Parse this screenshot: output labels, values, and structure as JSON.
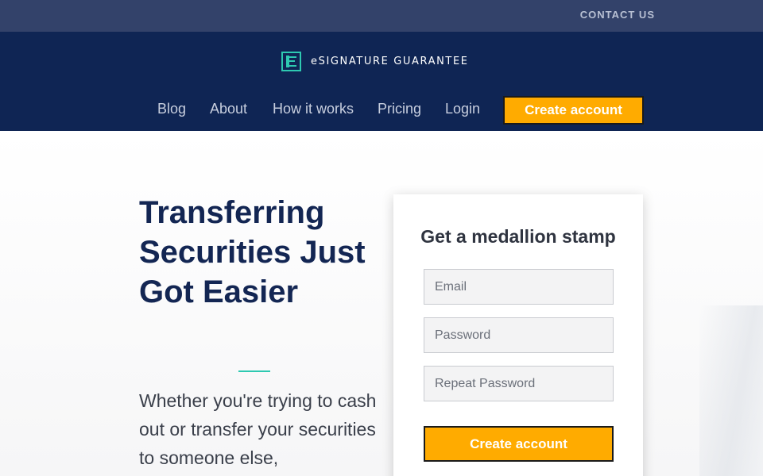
{
  "topbar": {
    "contact": "CONTACT US"
  },
  "brand": {
    "name": "eSIGNATURE GUARANTEE",
    "accent": "#2ec9b1"
  },
  "nav": {
    "items": [
      "Blog",
      "About",
      "How it works",
      "Pricing",
      "Login"
    ],
    "cta": "Create account"
  },
  "hero": {
    "title": "Transferring Securities Just Got Easier",
    "subtitle": "Whether you're trying to cash out or transfer your securities to someone else,"
  },
  "signup": {
    "title": "Get a medallion stamp",
    "email_placeholder": "Email",
    "password_placeholder": "Password",
    "repeat_placeholder": "Repeat Password",
    "submit": "Create account"
  },
  "colors": {
    "header_bg": "#0f2554",
    "topbar_bg": "#33426a",
    "cta": "#ffab00"
  }
}
